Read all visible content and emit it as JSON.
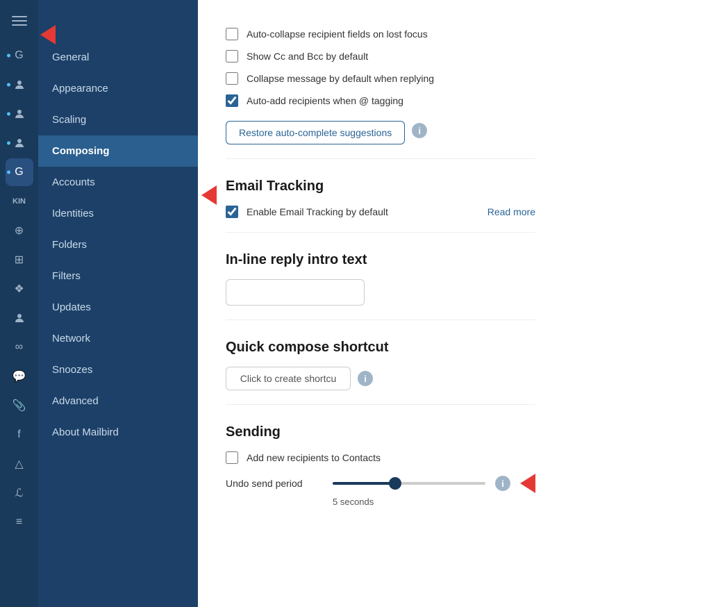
{
  "sidebar": {
    "items": [
      {
        "id": "general",
        "label": "General",
        "active": false
      },
      {
        "id": "appearance",
        "label": "Appearance",
        "active": false
      },
      {
        "id": "scaling",
        "label": "Scaling",
        "active": false
      },
      {
        "id": "composing",
        "label": "Composing",
        "active": true
      },
      {
        "id": "accounts",
        "label": "Accounts",
        "active": false
      },
      {
        "id": "identities",
        "label": "Identities",
        "active": false
      },
      {
        "id": "folders",
        "label": "Folders",
        "active": false
      },
      {
        "id": "filters",
        "label": "Filters",
        "active": false
      },
      {
        "id": "updates",
        "label": "Updates",
        "active": false
      },
      {
        "id": "network",
        "label": "Network",
        "active": false
      },
      {
        "id": "snoozes",
        "label": "Snoozes",
        "active": false
      },
      {
        "id": "advanced",
        "label": "Advanced",
        "active": false
      },
      {
        "id": "about",
        "label": "About Mailbird",
        "active": false
      }
    ]
  },
  "checkboxes": {
    "auto_collapse": {
      "label": "Auto-collapse recipient fields on lost focus",
      "checked": false
    },
    "show_cc_bcc": {
      "label": "Show Cc and Bcc by ",
      "highlight": "default",
      "checked": false
    },
    "collapse_reply": {
      "label": "Collapse message by default when replying",
      "checked": false
    },
    "auto_add": {
      "label": "Auto-add recipients when @ tagging",
      "checked": true
    }
  },
  "buttons": {
    "restore": "Restore auto-complete suggestions",
    "read_more": "Read more"
  },
  "sections": {
    "email_tracking": {
      "title": "Email Tracking",
      "enable_label": "Enable Email Tracking by default",
      "enable_checked": true
    },
    "inline_reply": {
      "title": "In-line reply intro text",
      "placeholder": ""
    },
    "quick_compose": {
      "title": "Quick compose shortcut",
      "button_label": "Click to create shortcu"
    },
    "sending": {
      "title": "Sending",
      "add_recipients_label": "Add new recipients to Contacts",
      "add_recipients_checked": false,
      "undo_label": "Undo send period",
      "undo_value": 40,
      "undo_seconds": "5 seconds"
    }
  }
}
